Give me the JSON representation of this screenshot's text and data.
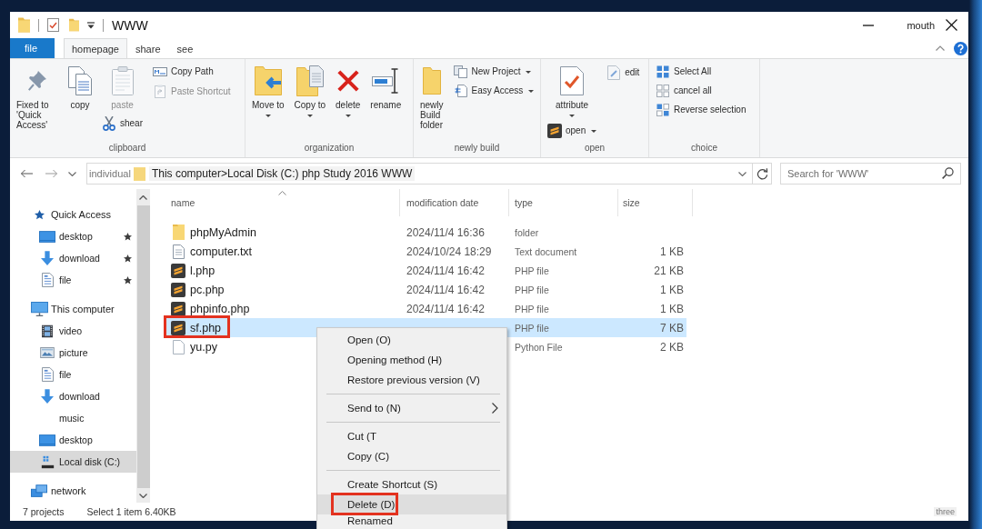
{
  "title_bar": {
    "title": "WWW",
    "caption_label": "mouth"
  },
  "ribbon_tabs": [
    {
      "label": "file",
      "kind": "file",
      "selected": false
    },
    {
      "label": "homepage",
      "kind": "tab",
      "selected": true
    },
    {
      "label": "share",
      "kind": "tab",
      "selected": false
    },
    {
      "label": "see",
      "kind": "tab",
      "selected": false
    }
  ],
  "ribbon": {
    "groups": [
      {
        "label": "clipboard",
        "columns": [
          [
            {
              "kind": "large",
              "label": "Fixed to 'Quick Access'",
              "dropdown": false,
              "disabled": false
            }
          ],
          [
            {
              "kind": "large",
              "label": "copy",
              "dropdown": false,
              "disabled": false
            }
          ],
          [
            {
              "kind": "large",
              "label": "paste",
              "dropdown": false,
              "disabled": true
            },
            {
              "kind": "small",
              "label": "shear",
              "dropdown": false,
              "disabled": false
            }
          ],
          [
            {
              "kind": "small",
              "label": "Copy Path",
              "dropdown": false,
              "disabled": false
            },
            {
              "kind": "small",
              "label": "Paste Shortcut",
              "dropdown": false,
              "disabled": true
            }
          ]
        ]
      },
      {
        "label": "organization",
        "columns": [
          [
            {
              "kind": "large",
              "label": "Move to",
              "dropdown": true,
              "disabled": false
            }
          ],
          [
            {
              "kind": "large",
              "label": "Copy to",
              "dropdown": true,
              "disabled": false
            }
          ],
          [
            {
              "kind": "large",
              "label": "delete",
              "dropdown": true,
              "disabled": false
            }
          ],
          [
            {
              "kind": "large",
              "label": "rename",
              "dropdown": false,
              "disabled": false
            }
          ]
        ]
      },
      {
        "label": "newly build",
        "columns": [
          [
            {
              "kind": "large",
              "label": "newly Build folder",
              "dropdown": false,
              "disabled": false
            }
          ],
          [
            {
              "kind": "small",
              "label": "New Project",
              "dropdown": true,
              "disabled": false
            },
            {
              "kind": "small",
              "label": "Easy Access",
              "dropdown": true,
              "disabled": false
            }
          ]
        ]
      },
      {
        "label": "open",
        "columns": [
          [
            {
              "kind": "large",
              "label": "attribute",
              "dropdown": true,
              "disabled": false
            },
            {
              "kind": "small",
              "label": "open",
              "dropdown": true,
              "disabled": false
            }
          ],
          [
            {
              "kind": "small",
              "label": "edit",
              "dropdown": false,
              "disabled": false
            }
          ]
        ]
      },
      {
        "label": "choice",
        "columns": [
          [
            {
              "kind": "small",
              "label": "Select All",
              "dropdown": false,
              "disabled": false
            },
            {
              "kind": "small",
              "label": "cancel all",
              "dropdown": false,
              "disabled": false
            },
            {
              "kind": "small",
              "label": "Reverse selection",
              "dropdown": false,
              "disabled": false
            }
          ]
        ]
      }
    ]
  },
  "address_bar": {
    "location_label": "individual",
    "path": "This computer>Local Disk (C:) php Study 2016 WWW"
  },
  "search": {
    "placeholder": "Search for 'WWW'"
  },
  "navigation": {
    "items": [
      {
        "label": "Quick Access",
        "kind": "quick_access",
        "selected": false,
        "pinned": false,
        "children": [
          {
            "label": "desktop",
            "kind": "desktop",
            "selected": false,
            "pinned": true
          },
          {
            "label": "download",
            "kind": "download",
            "selected": false,
            "pinned": true
          },
          {
            "label": "file",
            "kind": "document",
            "selected": false,
            "pinned": true
          }
        ]
      },
      {
        "label": "This computer",
        "kind": "computer",
        "selected": false,
        "pinned": false,
        "children": [
          {
            "label": "video",
            "kind": "video",
            "selected": false,
            "pinned": false
          },
          {
            "label": "picture",
            "kind": "picture",
            "selected": false,
            "pinned": false
          },
          {
            "label": "file",
            "kind": "document",
            "selected": false,
            "pinned": false
          },
          {
            "label": "download",
            "kind": "download",
            "selected": false,
            "pinned": false
          },
          {
            "label": "music",
            "kind": "music",
            "selected": false,
            "pinned": false
          },
          {
            "label": "desktop",
            "kind": "desktop",
            "selected": false,
            "pinned": false
          },
          {
            "label": "Local disk (C:)",
            "kind": "drive",
            "selected": true,
            "pinned": false
          }
        ]
      },
      {
        "label": "network",
        "kind": "network",
        "selected": false,
        "pinned": false
      }
    ]
  },
  "file_list": {
    "columns": [
      {
        "label": "name",
        "sorted": true
      },
      {
        "label": "modification date",
        "sorted": false
      },
      {
        "label": "type",
        "sorted": false
      },
      {
        "label": "size",
        "sorted": false
      }
    ],
    "rows": [
      {
        "name": "phpMyAdmin",
        "kind": "folder",
        "modified": "2024/11/4 16:36",
        "type": "folder",
        "selected": false,
        "highlighted": false
      },
      {
        "name": "computer.txt",
        "kind": "text",
        "modified": "2024/10/24 18:29",
        "type": "Text document",
        "size": "1 KB",
        "selected": false,
        "highlighted": false
      },
      {
        "name": "l.php",
        "kind": "php",
        "modified": "2024/11/4 16:42",
        "type": "PHP file",
        "size": "21 KB",
        "selected": false,
        "highlighted": false
      },
      {
        "name": "pc.php",
        "kind": "php",
        "modified": "2024/11/4 16:42",
        "type": "PHP file",
        "size": "1 KB",
        "selected": false,
        "highlighted": false
      },
      {
        "name": "phpinfo.php",
        "kind": "php",
        "modified": "2024/11/4 16:42",
        "type": "PHP file",
        "size": "1 KB",
        "selected": false,
        "highlighted": false
      },
      {
        "name": "sf.php",
        "kind": "php",
        "type": "PHP file",
        "size": "7 KB",
        "selected": true,
        "highlighted": true
      },
      {
        "name": "yu.py",
        "kind": "python",
        "type": "Python File",
        "size": "2 KB",
        "selected": false,
        "highlighted": false
      }
    ]
  },
  "context_menu": {
    "items": [
      {
        "kind": "item",
        "label": "Open (O)",
        "submenu": false,
        "selected": false,
        "highlighted": false
      },
      {
        "kind": "item",
        "label": "Opening method (H)",
        "submenu": false,
        "selected": false,
        "highlighted": false
      },
      {
        "kind": "item",
        "label": "Restore previous version (V)",
        "submenu": false,
        "selected": false,
        "highlighted": false
      },
      {
        "kind": "separator"
      },
      {
        "kind": "item",
        "label": "Send to (N)",
        "submenu": true,
        "selected": false,
        "highlighted": false
      },
      {
        "kind": "separator"
      },
      {
        "kind": "item",
        "label": "Cut (T",
        "submenu": false,
        "selected": false,
        "highlighted": false
      },
      {
        "kind": "item",
        "label": "Copy (C)",
        "submenu": false,
        "selected": false,
        "highlighted": false
      },
      {
        "kind": "separator"
      },
      {
        "kind": "item",
        "label": "Create Shortcut (S)",
        "submenu": false,
        "selected": false,
        "highlighted": false
      },
      {
        "kind": "item",
        "label": "Delete (D)",
        "submenu": false,
        "selected": true,
        "highlighted": true
      },
      {
        "kind": "item",
        "label": "Renamed",
        "submenu": false,
        "selected": false,
        "highlighted": false
      }
    ]
  },
  "status_bar": {
    "item_count": "7 projects",
    "selection": "Select 1 item 6.40KB",
    "view_label": "three"
  }
}
